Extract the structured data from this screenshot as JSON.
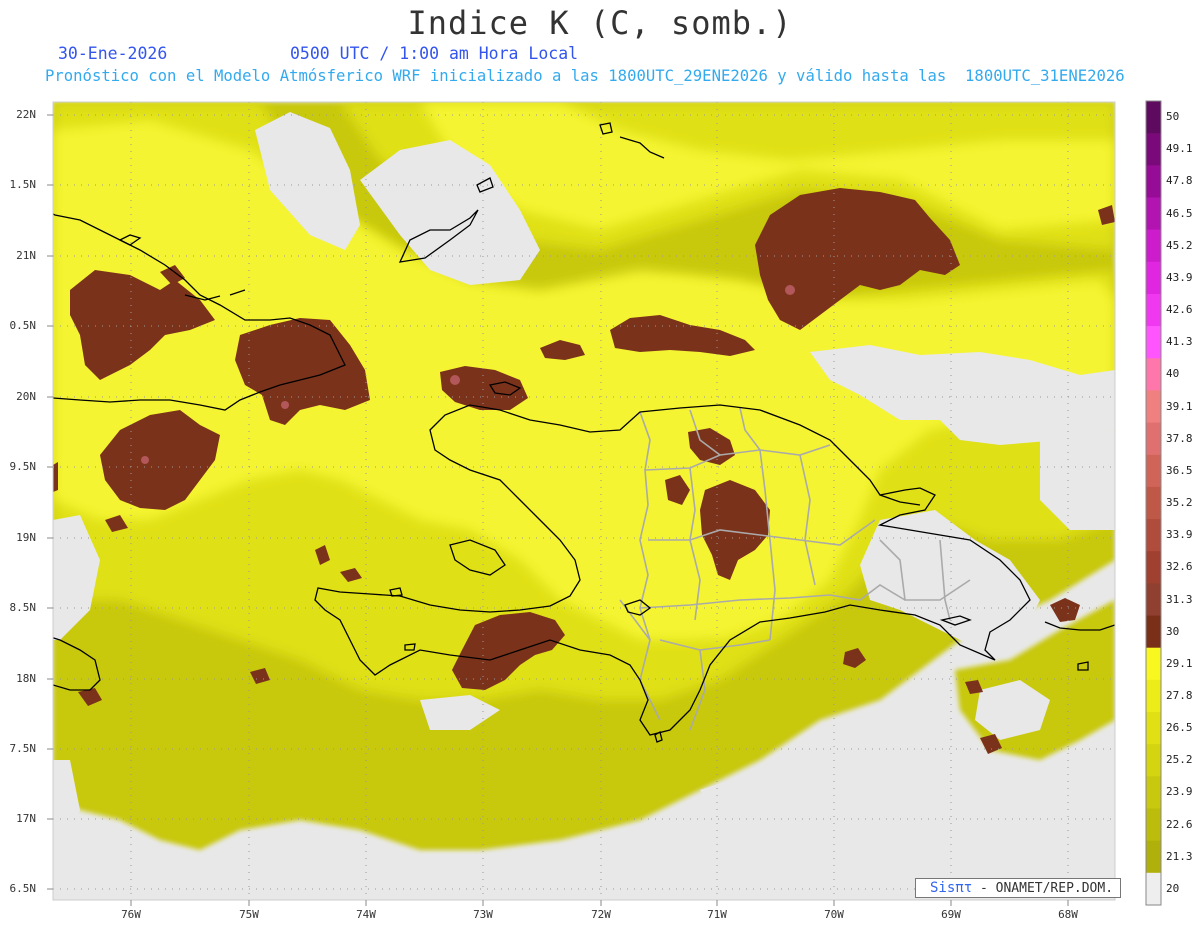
{
  "title": "Indice K (C, somb.)",
  "date": "30-Ene-2026",
  "time": "0500 UTC / 1:00 am Hora Local",
  "forecast_line": "Pronóstico con el Modelo Atmósferico WRF inicializado a las 1800UTC_29ENE2026 y válido hasta las  1800UTC_31ENE2026",
  "credit": {
    "brand": "Sisπτ",
    "org": "- ONAMET/REP.DOM."
  },
  "axes": {
    "y_labels": [
      "22N",
      "1.5N",
      "21N",
      "0.5N",
      "20N",
      "9.5N",
      "19N",
      "8.5N",
      "18N",
      "7.5N",
      "17N",
      "6.5N"
    ],
    "x_labels": [
      "76W",
      "75W",
      "74W",
      "73W",
      "72W",
      "71W",
      "70W",
      "69W",
      "68W"
    ]
  },
  "colorbar": {
    "labels": [
      "50",
      "49.1",
      "47.8",
      "46.5",
      "45.2",
      "43.9",
      "42.6",
      "41.3",
      "40",
      "39.1",
      "37.8",
      "36.5",
      "35.2",
      "33.9",
      "32.6",
      "31.3",
      "30",
      "29.1",
      "27.8",
      "26.5",
      "25.2",
      "23.9",
      "22.6",
      "21.3",
      "20"
    ],
    "colors": [
      "#5e0a5e",
      "#7a0a7a",
      "#960c96",
      "#b214b2",
      "#cc1ccc",
      "#e026e0",
      "#f038f0",
      "#ff55ff",
      "#ff77aa",
      "#f08080",
      "#e07070",
      "#d06458",
      "#c05848",
      "#b04c3c",
      "#a04030",
      "#904030",
      "#7a3018",
      "#f8f820",
      "#ecec18",
      "#e0e014",
      "#d4d410",
      "#c8c80e",
      "#bcbc0c",
      "#b0b00a",
      "#eeeeee"
    ]
  },
  "colors": {
    "land_no_data": "#e8e8e8",
    "low": "#c8c80e",
    "mid": "#e4e418",
    "high": "#f4f430",
    "max": "#7a3018",
    "coast": "#000000",
    "province_borders": "#aaaaaa"
  }
}
